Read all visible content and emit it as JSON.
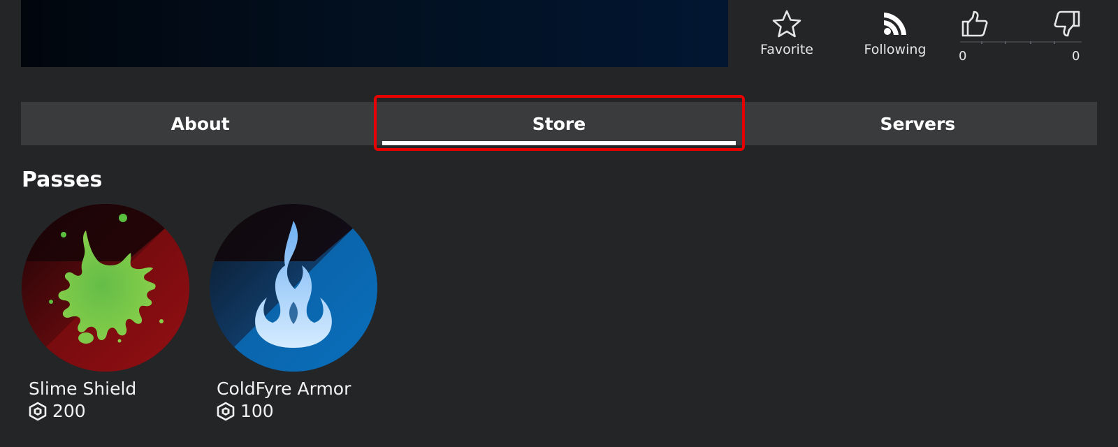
{
  "actions": {
    "favorite_label": "Favorite",
    "following_label": "Following",
    "upvotes": "0",
    "downvotes": "0"
  },
  "tabs": [
    {
      "label": "About",
      "active": false
    },
    {
      "label": "Store",
      "active": true
    },
    {
      "label": "Servers",
      "active": false
    }
  ],
  "store": {
    "section_title": "Passes",
    "passes": [
      {
        "name": "Slime Shield",
        "price": "200",
        "icon": "slime-splat-icon"
      },
      {
        "name": "ColdFyre Armor",
        "price": "100",
        "icon": "blue-flame-icon"
      }
    ]
  },
  "colors": {
    "background": "#232527",
    "tab_bar": "#393b3d",
    "highlight": "#e60000",
    "slime_green": "#5bbf3f",
    "slime_red": "#8e0e12",
    "cold_blue": "#0a74c4"
  }
}
